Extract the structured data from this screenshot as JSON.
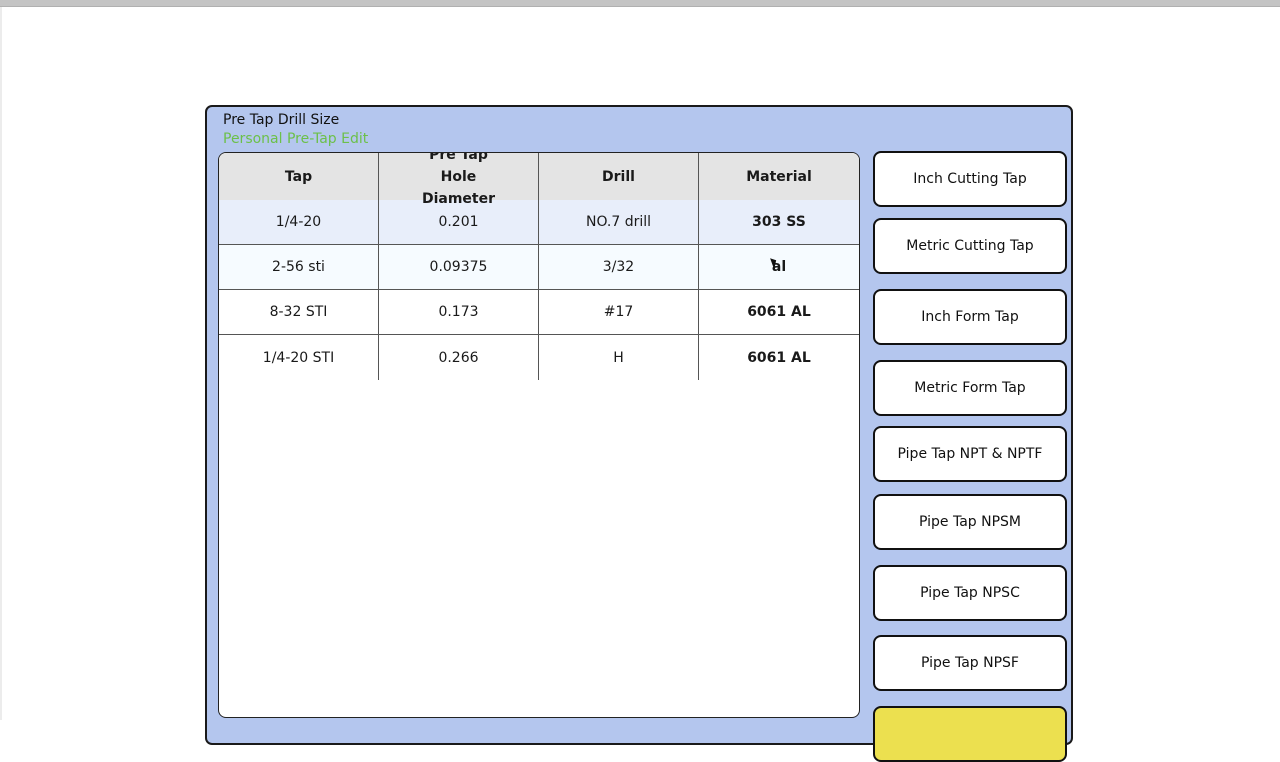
{
  "panel": {
    "title": "Pre Tap Drill Size",
    "subtitle": "Personal Pre-Tap Edit",
    "colors": {
      "panel_bg": "#b4c6ee",
      "subtitle": "#6cc04a",
      "header_bg": "#e4e4e4",
      "accent_button": "#ece04f"
    }
  },
  "table": {
    "columns": [
      "Tap",
      "Pre Tap Hole Diameter",
      "Drill",
      "Material"
    ],
    "rows": [
      {
        "tap": "1/4-20",
        "diameter": "0.201",
        "drill": "NO.7 drill",
        "material": "303 SS"
      },
      {
        "tap": "2-56 sti",
        "diameter": "0.09375",
        "drill": "3/32",
        "material": "al"
      },
      {
        "tap": "8-32 STI",
        "diameter": "0.173",
        "drill": "#17",
        "material": "6061 AL"
      },
      {
        "tap": "1/4-20 STI",
        "diameter": "0.266",
        "drill": "H",
        "material": "6061 AL"
      }
    ]
  },
  "sidebar": {
    "buttons": [
      {
        "label": "Inch Cutting Tap"
      },
      {
        "label": "Metric Cutting Tap"
      },
      {
        "label": "Inch Form Tap"
      },
      {
        "label": "Metric Form Tap"
      },
      {
        "label": "Pipe Tap NPT & NPTF"
      },
      {
        "label": "Pipe Tap NPSM"
      },
      {
        "label": "Pipe Tap NPSC"
      },
      {
        "label": "Pipe Tap NPSF"
      },
      {
        "label": ""
      }
    ]
  }
}
